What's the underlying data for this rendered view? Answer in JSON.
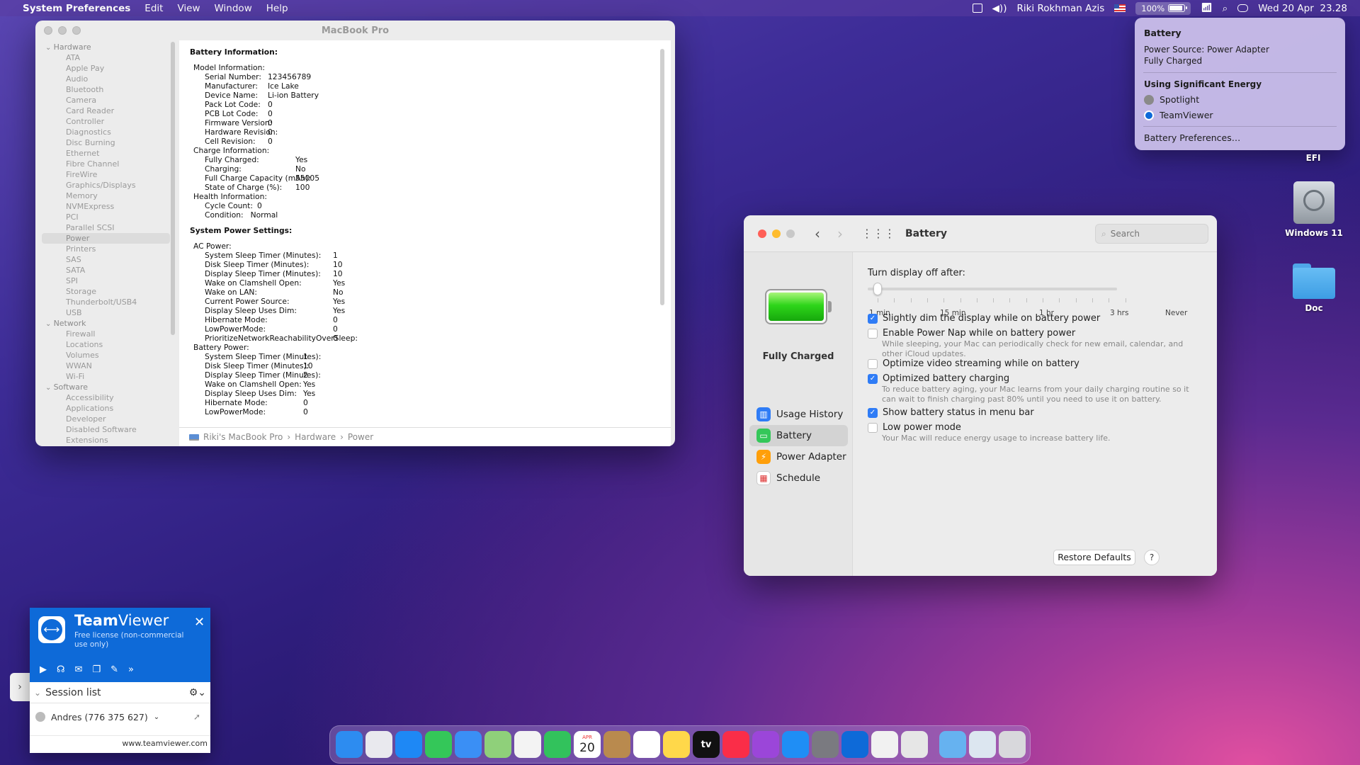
{
  "menubar": {
    "app_name": "System Preferences",
    "menus": [
      "Edit",
      "View",
      "Window",
      "Help"
    ],
    "user": "Riki Rokhman Azis",
    "battery_percent": "100%",
    "battery_level": 1.0,
    "datetime": "Wed 20 Apr  23.28",
    "icons": [
      "apple-icon",
      "activity-monitor-icon",
      "volume-icon",
      "us-flag-icon",
      "battery-icon",
      "wifi-icon",
      "spotlight-search-icon",
      "control-center-icon"
    ]
  },
  "battery_menu": {
    "title": "Battery",
    "power_source": "Power Source: Power Adapter",
    "status": "Fully Charged",
    "section": "Using Significant Energy",
    "apps": [
      "Spotlight",
      "TeamViewer"
    ],
    "prefs_link": "Battery Preferences…"
  },
  "desktop": {
    "icons": [
      {
        "label": "EFI"
      },
      {
        "label": "Windows 11"
      },
      {
        "label": "Doc"
      }
    ]
  },
  "sysinfo": {
    "window_title": "MacBook Pro",
    "tree": [
      {
        "type": "grp",
        "label": "Hardware"
      },
      {
        "type": "it",
        "label": "ATA"
      },
      {
        "type": "it",
        "label": "Apple Pay"
      },
      {
        "type": "it",
        "label": "Audio"
      },
      {
        "type": "it",
        "label": "Bluetooth"
      },
      {
        "type": "it",
        "label": "Camera"
      },
      {
        "type": "it",
        "label": "Card Reader"
      },
      {
        "type": "it",
        "label": "Controller"
      },
      {
        "type": "it",
        "label": "Diagnostics"
      },
      {
        "type": "it",
        "label": "Disc Burning"
      },
      {
        "type": "it",
        "label": "Ethernet"
      },
      {
        "type": "it",
        "label": "Fibre Channel"
      },
      {
        "type": "it",
        "label": "FireWire"
      },
      {
        "type": "it",
        "label": "Graphics/Displays"
      },
      {
        "type": "it",
        "label": "Memory"
      },
      {
        "type": "it",
        "label": "NVMExpress"
      },
      {
        "type": "it",
        "label": "PCI"
      },
      {
        "type": "it",
        "label": "Parallel SCSI"
      },
      {
        "type": "it",
        "label": "Power",
        "selected": true
      },
      {
        "type": "it",
        "label": "Printers"
      },
      {
        "type": "it",
        "label": "SAS"
      },
      {
        "type": "it",
        "label": "SATA"
      },
      {
        "type": "it",
        "label": "SPI"
      },
      {
        "type": "it",
        "label": "Storage"
      },
      {
        "type": "it",
        "label": "Thunderbolt/USB4"
      },
      {
        "type": "it",
        "label": "USB"
      },
      {
        "type": "grp",
        "label": "Network"
      },
      {
        "type": "it",
        "label": "Firewall"
      },
      {
        "type": "it",
        "label": "Locations"
      },
      {
        "type": "it",
        "label": "Volumes"
      },
      {
        "type": "it",
        "label": "WWAN"
      },
      {
        "type": "it",
        "label": "Wi-Fi"
      },
      {
        "type": "grp",
        "label": "Software"
      },
      {
        "type": "it",
        "label": "Accessibility"
      },
      {
        "type": "it",
        "label": "Applications"
      },
      {
        "type": "it",
        "label": "Developer"
      },
      {
        "type": "it",
        "label": "Disabled Software"
      },
      {
        "type": "it",
        "label": "Extensions"
      }
    ],
    "battery_heading": "Battery Information:",
    "model_heading": "Model Information:",
    "model_info": [
      [
        "Serial Number:",
        "123456789"
      ],
      [
        "Manufacturer:",
        "Ice Lake"
      ],
      [
        "Device Name:",
        "Li-ion Battery"
      ],
      [
        "Pack Lot Code:",
        "0"
      ],
      [
        "PCB Lot Code:",
        "0"
      ],
      [
        "Firmware Version:",
        "0"
      ],
      [
        "Hardware Revision:",
        "0"
      ],
      [
        "Cell Revision:",
        "0"
      ]
    ],
    "charge_heading": "Charge Information:",
    "charge_info": [
      [
        "Fully Charged:",
        "Yes"
      ],
      [
        "Charging:",
        "No"
      ],
      [
        "Full Charge Capacity (mAh):",
        "55005"
      ],
      [
        "State of Charge (%):",
        "100"
      ]
    ],
    "health_heading": "Health Information:",
    "health_info": [
      [
        "Cycle Count:",
        "0"
      ],
      [
        "Condition:",
        "Normal"
      ]
    ],
    "power_heading": "System Power Settings:",
    "ac_heading": "AC Power:",
    "ac_power": [
      [
        "System Sleep Timer (Minutes):",
        "1"
      ],
      [
        "Disk Sleep Timer (Minutes):",
        "10"
      ],
      [
        "Display Sleep Timer (Minutes):",
        "10"
      ],
      [
        "Wake on Clamshell Open:",
        "Yes"
      ],
      [
        "Wake on LAN:",
        "No"
      ],
      [
        "Current Power Source:",
        "Yes"
      ],
      [
        "Display Sleep Uses Dim:",
        "Yes"
      ],
      [
        "Hibernate Mode:",
        "0"
      ],
      [
        "LowPowerMode:",
        "0"
      ],
      [
        "PrioritizeNetworkReachabilityOverSleep:",
        "0"
      ]
    ],
    "batt_heading": "Battery Power:",
    "battery_power": [
      [
        "System Sleep Timer (Minutes):",
        "1"
      ],
      [
        "Disk Sleep Timer (Minutes):",
        "10"
      ],
      [
        "Display Sleep Timer (Minutes):",
        "2"
      ],
      [
        "Wake on Clamshell Open:",
        "Yes"
      ],
      [
        "Display Sleep Uses Dim:",
        "Yes"
      ],
      [
        "Hibernate Mode:",
        "0"
      ],
      [
        "LowPowerMode:",
        "0"
      ]
    ],
    "path": [
      "Riki's MacBook Pro",
      "Hardware",
      "Power"
    ]
  },
  "prefs": {
    "title": "Battery",
    "search_placeholder": "Search",
    "status": "Fully Charged",
    "nav": [
      {
        "label": "Usage History",
        "icon": "usage-history-icon",
        "color": "#2f7cf6"
      },
      {
        "label": "Battery",
        "icon": "battery-icon",
        "color": "#34c759",
        "selected": true
      },
      {
        "label": "Power Adapter",
        "icon": "power-adapter-icon",
        "color": "#ff9f0a"
      },
      {
        "label": "Schedule",
        "icon": "schedule-icon",
        "color": "#ffffff"
      }
    ],
    "slider_label": "Turn display off after:",
    "slider_ticks": [
      "1 min",
      "15 min",
      "1 hr",
      "3 hrs",
      "Never"
    ],
    "slider_value": "1 min",
    "options": [
      {
        "label": "Slightly dim the display while on battery power",
        "checked": true,
        "desc": ""
      },
      {
        "label": "Enable Power Nap while on battery power",
        "checked": false,
        "desc": "While sleeping, your Mac can periodically check for new email, calendar, and other iCloud updates."
      },
      {
        "label": "Optimize video streaming while on battery",
        "checked": false,
        "desc": ""
      },
      {
        "label": "Optimized battery charging",
        "checked": true,
        "desc": "To reduce battery aging, your Mac learns from your daily charging routine so it can wait to finish charging past 80% until you need to use it on battery."
      },
      {
        "label": "Show battery status in menu bar",
        "checked": true,
        "desc": ""
      },
      {
        "label": "Low power mode",
        "checked": false,
        "desc": "Your Mac will reduce energy usage to increase battery life."
      }
    ],
    "restore_label": "Restore Defaults",
    "help_label": "?"
  },
  "teamviewer": {
    "brand_bold": "Team",
    "brand_light": "Viewer",
    "license": "Free license (non-commercial use only)",
    "session_list": "Session list",
    "contact": "Andres (776 375 627)",
    "url": "www.teamviewer.com"
  },
  "dock": {
    "apps": [
      {
        "name": "finder-icon",
        "color": "#2d8cf0"
      },
      {
        "name": "launchpad-icon",
        "color": "#e9e9ee"
      },
      {
        "name": "safari-icon",
        "color": "#1e88f5"
      },
      {
        "name": "messages-icon",
        "color": "#34c759"
      },
      {
        "name": "mail-icon",
        "color": "#3a8ff5"
      },
      {
        "name": "maps-icon",
        "color": "#8fd07a"
      },
      {
        "name": "photos-icon",
        "color": "#f3f3f3"
      },
      {
        "name": "facetime-icon",
        "color": "#32c25c"
      },
      {
        "name": "calendar-icon",
        "color": "#ffffff",
        "text": "20",
        "month": "APR"
      },
      {
        "name": "contacts-icon",
        "color": "#b98a4e"
      },
      {
        "name": "reminders-icon",
        "color": "#ffffff"
      },
      {
        "name": "notes-icon",
        "color": "#ffd84a"
      },
      {
        "name": "apple-tv-icon",
        "color": "#111111",
        "text": "tv"
      },
      {
        "name": "music-icon",
        "color": "#fa2d48"
      },
      {
        "name": "podcasts-icon",
        "color": "#9b46d9"
      },
      {
        "name": "app-store-icon",
        "color": "#1f8ef5"
      },
      {
        "name": "system-preferences-icon",
        "color": "#7a7a80"
      },
      {
        "name": "teamviewer-icon",
        "color": "#0e6ad8"
      },
      {
        "name": "textedit-icon",
        "color": "#f1f1f1"
      },
      {
        "name": "printer-icon",
        "color": "#e6e6e6"
      }
    ],
    "extras": [
      {
        "name": "downloads-folder-icon",
        "color": "#66b2f0"
      },
      {
        "name": "screenshot-stack-icon",
        "color": "#dce6f0"
      },
      {
        "name": "trash-icon",
        "color": "#d8d8dc"
      }
    ]
  }
}
